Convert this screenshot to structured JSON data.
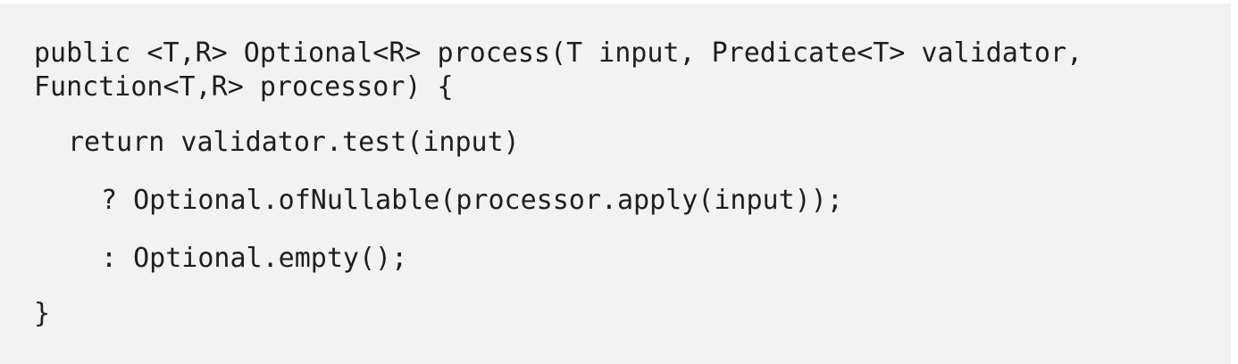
{
  "code": {
    "signature_line_1": "public <T,R> Optional<R> process(T input, Predicate<T> validator,",
    "signature_line_2": "Function<T,R> processor) {",
    "return_line": "return validator.test(input)",
    "true_branch": "? Optional.ofNullable(processor.apply(input));",
    "false_branch": ": Optional.empty();",
    "closing_brace": "}"
  }
}
